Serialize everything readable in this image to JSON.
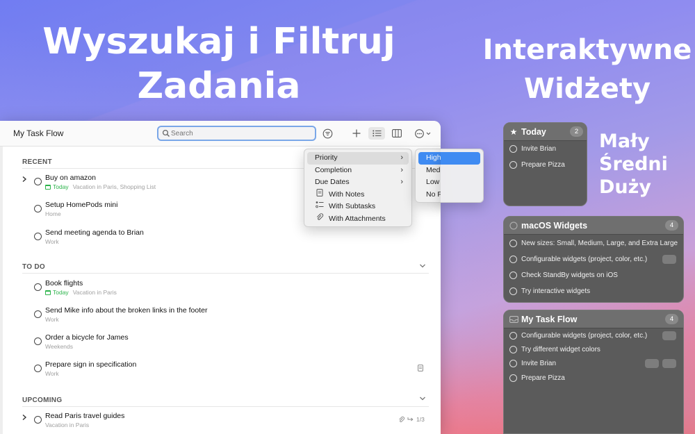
{
  "headline_left": [
    "Wyszukaj i Filtruj",
    "Zadania"
  ],
  "headline_right": [
    "Interaktywne",
    "Widżety"
  ],
  "sizes": [
    "Mały",
    "Średni",
    "Duży"
  ],
  "app": {
    "title": "My Task Flow",
    "search_placeholder": "Search",
    "toolbar_icons": [
      "filter-icon",
      "plus-icon",
      "list-view-icon",
      "board-view-icon",
      "more-icon"
    ]
  },
  "sections": {
    "recent": "RECENT",
    "todo": "TO DO",
    "upcoming": "UPCOMING"
  },
  "tasks": {
    "recent": [
      {
        "title": "Buy on amazon",
        "today": "Today",
        "meta": "Vacation in Paris, Shopping List",
        "expandable": true
      },
      {
        "title": "Setup HomePods mini",
        "meta": "Home"
      },
      {
        "title": "Send meeting agenda to Brian",
        "meta": "Work"
      }
    ],
    "todo": [
      {
        "title": "Book flights",
        "today": "Today",
        "meta": "Vacation in Paris"
      },
      {
        "title": "Send Mike info about the broken links in the footer",
        "meta": "Work"
      },
      {
        "title": "Order a bicycle for James",
        "meta": "Weekends"
      },
      {
        "title": "Prepare sign in specification",
        "meta": "Work"
      }
    ],
    "upcoming": [
      {
        "title": "Read Paris travel guides",
        "meta": "Vacation in Paris",
        "subtasks": "1/3",
        "expandable": true
      }
    ]
  },
  "filter_menu": {
    "items": [
      "Priority",
      "Completion",
      "Due Dates",
      "With Notes",
      "With Subtasks",
      "With Attachments"
    ]
  },
  "priority_menu": {
    "items": [
      "High Priority",
      "Medium Priority",
      "Low Priority",
      "No Priority"
    ],
    "selected": "High Priority"
  },
  "widgets": {
    "small": {
      "title": "Today",
      "count": "2",
      "items": [
        "Invite Brian",
        "Prepare Pizza"
      ]
    },
    "medium": {
      "title": "macOS Widgets",
      "count": "4",
      "items": [
        "New sizes: Small, Medium, Large, and Extra Large",
        "Configurable widgets (project, color, etc.)",
        "Check StandBy widgets on iOS",
        "Try interactive widgets"
      ]
    },
    "large": {
      "title": "My Task Flow",
      "count": "4",
      "items": [
        "Configurable widgets (project, color, etc.)",
        "Try different widget colors",
        "Invite Brian",
        "Prepare Pizza"
      ]
    }
  },
  "colors": {
    "accent": "#3f8bf2",
    "today_green": "#2bb34a",
    "widget_bg": "#5b5b5b"
  }
}
